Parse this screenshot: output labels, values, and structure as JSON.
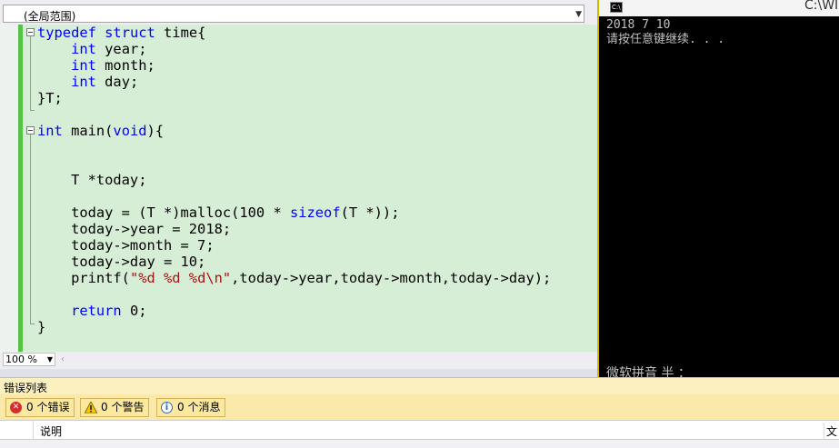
{
  "scope": {
    "value": "(全局范围)"
  },
  "editor": {
    "lines": [
      {
        "segs": [
          {
            "t": "typedef",
            "c": "kw"
          },
          {
            "t": " ",
            "c": ""
          },
          {
            "t": "struct",
            "c": "kw"
          },
          {
            "t": " time{",
            "c": ""
          }
        ]
      },
      {
        "segs": [
          {
            "t": "    ",
            "c": ""
          },
          {
            "t": "int",
            "c": "kw"
          },
          {
            "t": " year;",
            "c": ""
          }
        ]
      },
      {
        "segs": [
          {
            "t": "    ",
            "c": ""
          },
          {
            "t": "int",
            "c": "kw"
          },
          {
            "t": " month;",
            "c": ""
          }
        ]
      },
      {
        "segs": [
          {
            "t": "    ",
            "c": ""
          },
          {
            "t": "int",
            "c": "kw"
          },
          {
            "t": " day;",
            "c": ""
          }
        ]
      },
      {
        "segs": [
          {
            "t": "}T;",
            "c": ""
          }
        ]
      },
      {
        "segs": []
      },
      {
        "segs": [
          {
            "t": "int",
            "c": "kw"
          },
          {
            "t": " main(",
            "c": ""
          },
          {
            "t": "void",
            "c": "kw"
          },
          {
            "t": "){",
            "c": ""
          }
        ]
      },
      {
        "segs": []
      },
      {
        "segs": []
      },
      {
        "segs": [
          {
            "t": "    T *today;",
            "c": ""
          }
        ]
      },
      {
        "segs": []
      },
      {
        "segs": [
          {
            "t": "    today = (T *)malloc(100 * ",
            "c": ""
          },
          {
            "t": "sizeof",
            "c": "kw"
          },
          {
            "t": "(T *));",
            "c": ""
          }
        ]
      },
      {
        "segs": [
          {
            "t": "    today->year = 2018;",
            "c": ""
          }
        ]
      },
      {
        "segs": [
          {
            "t": "    today->month = 7;",
            "c": ""
          }
        ]
      },
      {
        "segs": [
          {
            "t": "    today->day = 10;",
            "c": ""
          }
        ]
      },
      {
        "segs": [
          {
            "t": "    printf(",
            "c": ""
          },
          {
            "t": "\"%d %d %d\\n\"",
            "c": "str"
          },
          {
            "t": ",today->year,today->month,today->day);",
            "c": ""
          }
        ]
      },
      {
        "segs": []
      },
      {
        "segs": [
          {
            "t": "    ",
            "c": ""
          },
          {
            "t": "return",
            "c": "kw"
          },
          {
            "t": " 0;",
            "c": ""
          }
        ]
      },
      {
        "segs": [
          {
            "t": "}",
            "c": ""
          }
        ]
      }
    ]
  },
  "zoom": {
    "value": "100 %"
  },
  "console": {
    "title": "C:\\WI",
    "output": "2018 7 10\n请按任意键继续. . .",
    "ime": "微软拼音 半 ："
  },
  "errors": {
    "title": "错误列表",
    "filters": {
      "errors": "0 个错误",
      "warnings": "0 个警告",
      "messages": "0 个消息"
    },
    "columns": {
      "description": "说明",
      "file": "文"
    }
  },
  "colors": {
    "keyword": "#0000ff",
    "string": "#a31515",
    "editor_bg": "#d6edd6",
    "change_bar": "#56c346"
  }
}
